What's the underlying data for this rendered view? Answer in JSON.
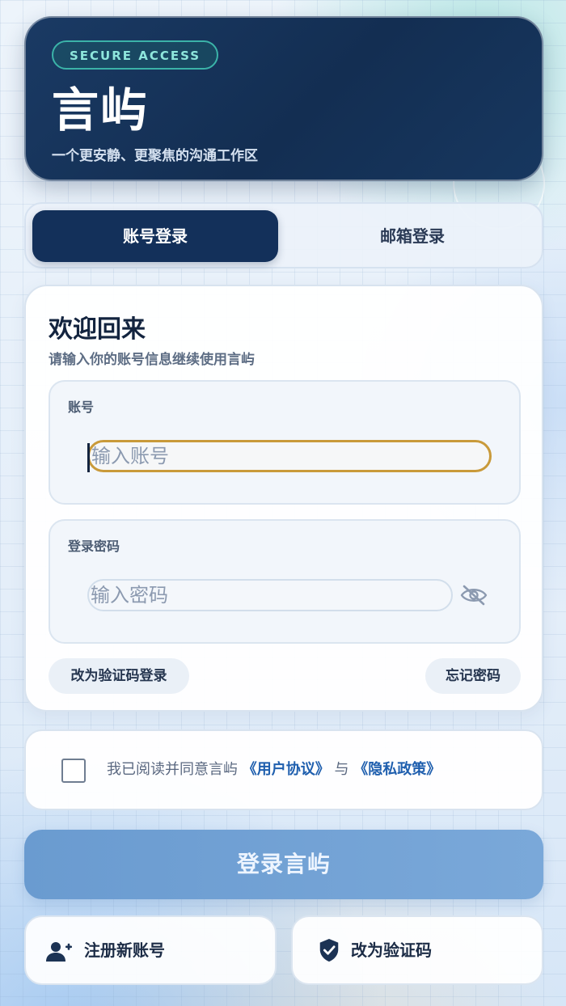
{
  "header": {
    "badge": "SECURE ACCESS",
    "title": "言屿",
    "subtitle": "一个更安静、更聚焦的沟通工作区"
  },
  "tabs": [
    {
      "label": "账号登录",
      "active": true
    },
    {
      "label": "邮箱登录",
      "active": false
    }
  ],
  "login": {
    "heading": "欢迎回来",
    "subheading": "请输入你的账号信息继续使用言屿",
    "account": {
      "label": "账号",
      "placeholder": "输入账号",
      "value": ""
    },
    "password": {
      "label": "登录密码",
      "placeholder": "输入密码",
      "value": ""
    },
    "switch_code_label": "改为验证码登录",
    "forgot_label": "忘记密码"
  },
  "agreement": {
    "checked": false,
    "prefix": "我已阅读并同意言屿",
    "terms_link": "《用户协议》",
    "connector": "与",
    "privacy_link": "《隐私政策》"
  },
  "primary_button": "登录言屿",
  "bottom": {
    "register_label": "注册新账号",
    "register_icon": "add-user-icon",
    "code_label": "改为验证码",
    "code_icon": "shield-check-icon"
  },
  "colors": {
    "brand_dark": "#13305a",
    "accent_teal": "#3bb3a8",
    "focus_border": "#c99a3a",
    "link": "#1f5fae",
    "primary_button": "#7aa8d9"
  }
}
